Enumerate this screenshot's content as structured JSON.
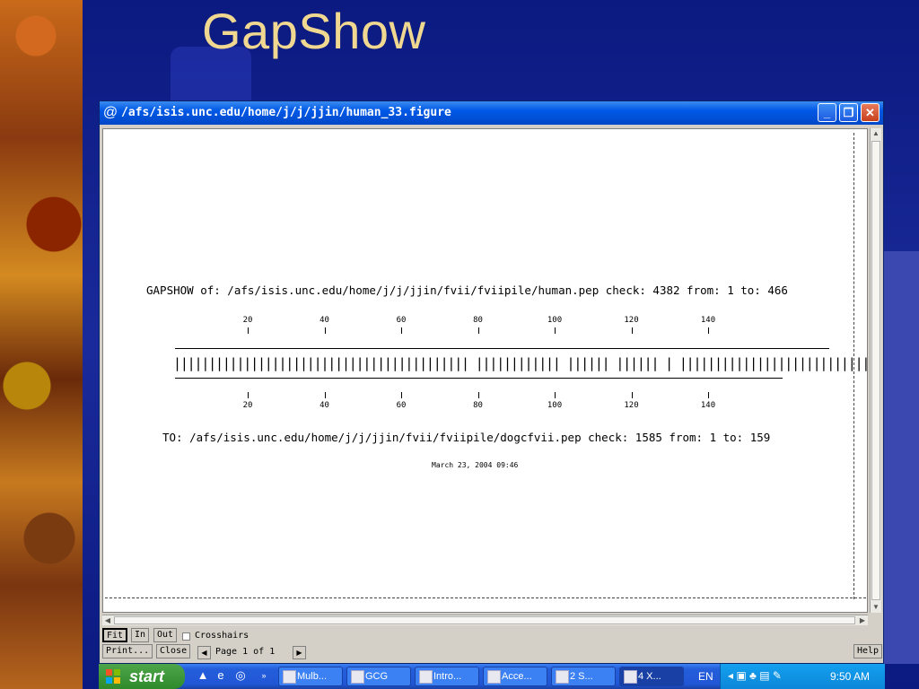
{
  "slide": {
    "title": "GapShow"
  },
  "window": {
    "title": "/afs/isis.unc.edu/home/j/j/jjin/human_33.figure",
    "controls": {
      "minimize": "_",
      "maximize": "❐",
      "close": "✕"
    }
  },
  "figure": {
    "gapshow_line": "GAPSHOW of: /afs/isis.unc.edu/home/j/j/jjin/fvii/fviipile/human.pep  check: 4382  from: 1  to: 466",
    "ticks": [
      "20",
      "40",
      "60",
      "80",
      "100",
      "120",
      "140"
    ],
    "bars": "|||||||||||||||||||||||||||||||||||||||||| |||||||||||| |||||| |||||| | |||||||||||||||||||||||||||||||||||||||| |||||||||||||||||| ||||||||||||||||||||||||",
    "to_line": "TO: /afs/isis.unc.edu/home/j/j/jjin/fvii/fviipile/dogcfvii.pep  check: 1585  from: 1  to: 159",
    "date": "March 23, 2004 09:46"
  },
  "controls": {
    "fit": "Fit",
    "in": "In",
    "out": "Out",
    "crosshairs": "Crosshairs",
    "print": "Print...",
    "close": "Close",
    "page_label": "Page  1 of  1",
    "help": "Help"
  },
  "taskbar": {
    "start": "start",
    "tasks": [
      "Mulb...",
      "GCG",
      "Intro...",
      "Acce...",
      "2 S...",
      "4 X..."
    ],
    "language": "EN",
    "clock": "9:50 AM"
  }
}
